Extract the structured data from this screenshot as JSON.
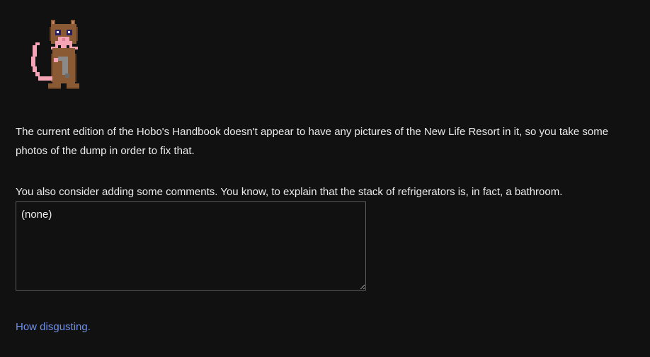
{
  "creature": {
    "icon": "pixel-cat-creature-with-tentacles-icon",
    "colors": {
      "fur": "#8a5a34",
      "fur_dark": "#5d3b20",
      "tentacles": "#f4a4b4",
      "eyes": "#2a1f66",
      "tool": "#8a8a8a"
    }
  },
  "intro": {
    "text": "The current edition of the Hobo's Handbook doesn't appear to have any pictures of the New Life Resort in it, so you take some photos of the dump in order to fix that."
  },
  "comments": {
    "prompt": "You also consider adding some comments. You know, to explain that the stack of refrigerators is, in fact, a bathroom.",
    "value": "(none)"
  },
  "action": {
    "label": "How disgusting."
  },
  "colors": {
    "background": "#111111",
    "text": "#ececec",
    "link": "#6f8fe9",
    "border": "#5c5c5c"
  }
}
